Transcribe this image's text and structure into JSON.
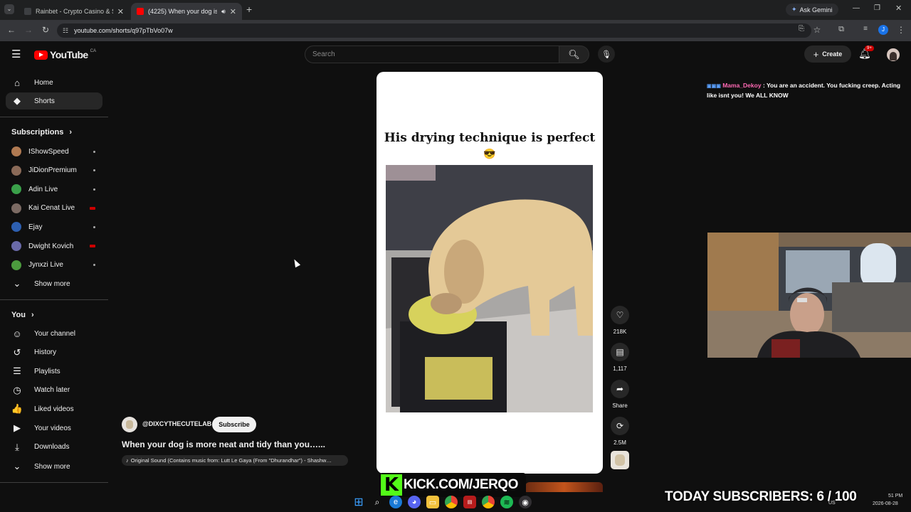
{
  "browser": {
    "tabs": [
      {
        "title": "Rainbet - Crypto Casino & Spo",
        "active": false,
        "favicon_color": "#3d3f42"
      },
      {
        "title": "(4225) When your dog is m",
        "active": true,
        "favicon_color": "#ff0000"
      }
    ],
    "new_tab": "+",
    "ask_gemini": "Ask Gemini",
    "url": "youtube.com/shorts/q97pTbVo07w"
  },
  "youtube": {
    "logo": "YouTube",
    "region": "CA",
    "search_placeholder": "Search",
    "create_label": "Create",
    "notification_badge": "9+",
    "sidebar": {
      "main": [
        {
          "label": "Home",
          "icon": "home-icon",
          "glyph": "⌂"
        },
        {
          "label": "Shorts",
          "icon": "shorts-icon",
          "glyph": "◆"
        }
      ],
      "subscriptions_title": "Subscriptions",
      "subscriptions": [
        {
          "label": "IShowSpeed",
          "color": "#b07a52",
          "status": "dot"
        },
        {
          "label": "JiDionPremium",
          "color": "#8a6a58",
          "status": "dot"
        },
        {
          "label": "Adin Live",
          "color": "#3aa04a",
          "status": "dot"
        },
        {
          "label": "Kai Cenat Live",
          "color": "#7b6a63",
          "status": "live"
        },
        {
          "label": "Ejay",
          "color": "#2d5fb0",
          "status": "dot"
        },
        {
          "label": "Dwight Kovich",
          "color": "#6a6aa8",
          "status": "live"
        },
        {
          "label": "Jynxzi Live",
          "color": "#4c9a3e",
          "status": "dot"
        }
      ],
      "subs_show_more": "Show more",
      "you_title": "You",
      "you_items": [
        {
          "label": "Your channel",
          "icon": "channel-icon",
          "glyph": "☺"
        },
        {
          "label": "History",
          "icon": "history-icon",
          "glyph": "↺"
        },
        {
          "label": "Playlists",
          "icon": "playlists-icon",
          "glyph": "☰"
        },
        {
          "label": "Watch later",
          "icon": "clock-icon",
          "glyph": "◷"
        },
        {
          "label": "Liked videos",
          "icon": "thumbs-up-icon",
          "glyph": "👍"
        },
        {
          "label": "Your videos",
          "icon": "your-videos-icon",
          "glyph": "▶"
        },
        {
          "label": "Downloads",
          "icon": "download-icon",
          "glyph": "⤓"
        }
      ],
      "you_show_more": "Show more"
    },
    "short": {
      "caption_title": "His drying technique is perfect",
      "caption_emoji": "😎",
      "channel": "@DIXCYTHECUTELAB",
      "subscribe": "Subscribe",
      "video_title": "When your dog is more neat and tidy than you…...",
      "sound": "Original Sound (Contains music from: Lutt Le Gaya (From \"Dhurandhar\") - Shashw…",
      "actions": [
        {
          "icon": "like-icon",
          "glyph": "♡",
          "label": "218K"
        },
        {
          "icon": "comment-icon",
          "glyph": "▤",
          "label": "1,117"
        },
        {
          "icon": "share-icon",
          "glyph": "➦",
          "label": "Share"
        },
        {
          "icon": "remix-icon",
          "glyph": "⟳",
          "label": "2.5M"
        }
      ]
    }
  },
  "overlay": {
    "chat_user": "Mama_Dekoy",
    "chat_message": ": You are an accident. You fucking creep. Acting like isnt you! We ALL KNOW",
    "kick_text": "KICK.COM/JERQO",
    "subscribers_text": "TODAY SUBSCRIBERS: 6 / 100"
  },
  "taskbar": {
    "clock_time": "51 PM",
    "clock_date": "2026-08-28",
    "locale": "US"
  },
  "colors": {
    "yt_red": "#ff0000",
    "kick_green": "#53fc18",
    "chat_user": "#ff69b4"
  }
}
